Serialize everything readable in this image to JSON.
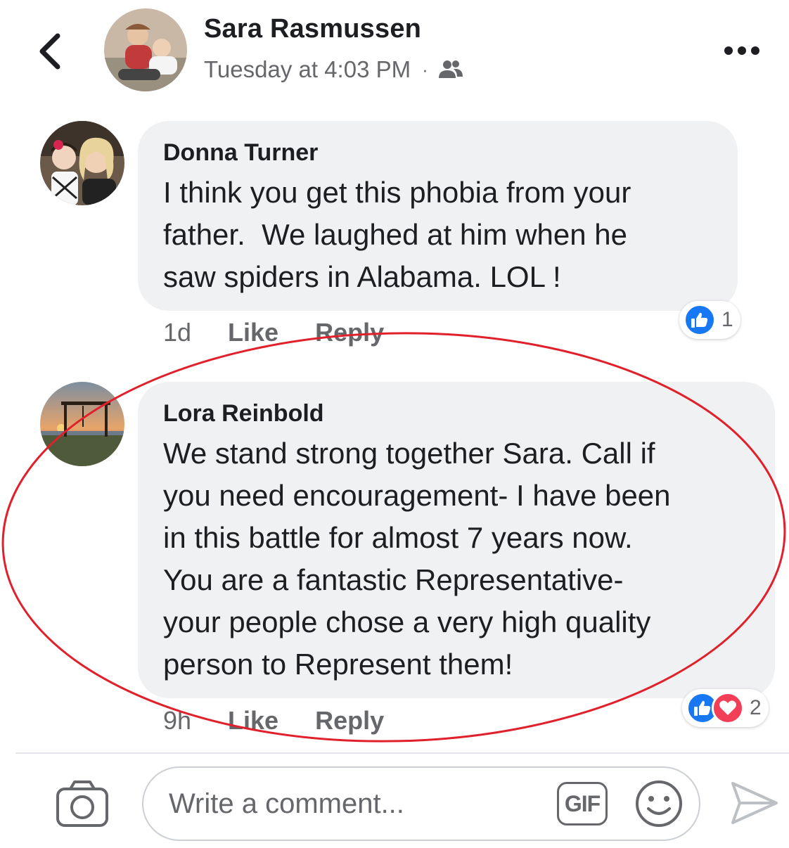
{
  "post": {
    "author": "Sara Rasmussen",
    "timestamp": "Tuesday at 4:03 PM",
    "separator": "·",
    "audience_icon": "friends-icon"
  },
  "comments": [
    {
      "author": "Donna Turner",
      "text": "I think you get this phobia from your\nfather.  We laughed at him when he\nsaw spiders in Alabama. LOL !",
      "time": "1d",
      "like_label": "Like",
      "reply_label": "Reply",
      "reactions": [
        "like"
      ],
      "reaction_count": "1"
    },
    {
      "author": "Lora Reinbold",
      "text": "We stand strong together Sara. Call if\nyou need encouragement- I have been\nin this battle for almost 7 years now.\nYou are a fantastic Representative-\nyour people chose a very high quality\nperson to Represent them!",
      "time": "9h",
      "like_label": "Like",
      "reply_label": "Reply",
      "reactions": [
        "like",
        "love"
      ],
      "reaction_count": "2"
    }
  ],
  "composer": {
    "placeholder": "Write a comment...",
    "gif_label": "GIF"
  },
  "colors": {
    "like_blue": "#1877f2",
    "love_red": "#f33e58",
    "highlight_red": "#e0202a",
    "bubble_gray": "#f0f1f3",
    "meta_gray": "#65676b"
  }
}
